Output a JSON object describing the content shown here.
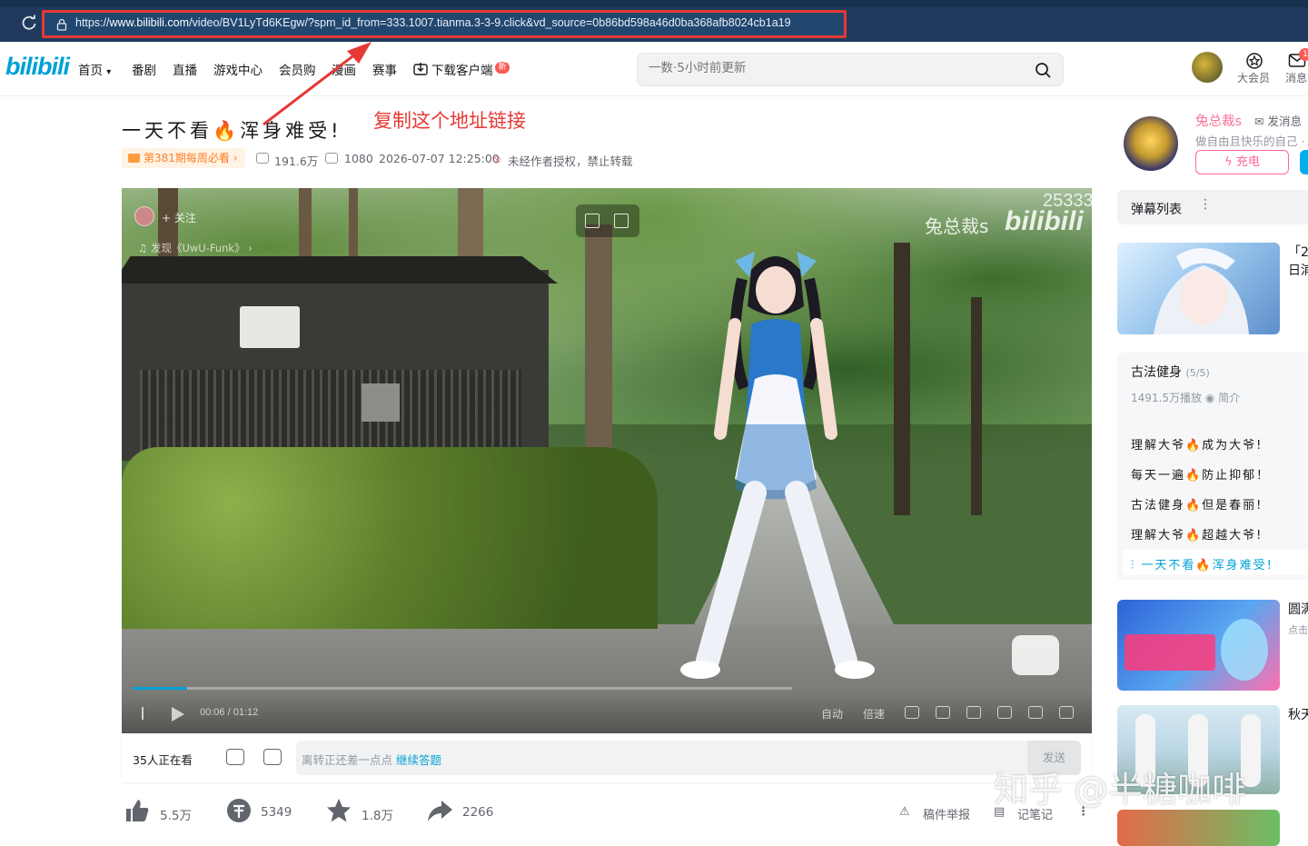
{
  "browser": {
    "url_prefix": "https://",
    "url_host": "www.bilibili.com",
    "url_rest": "/video/BV1LyTd6KEgw/?spm_id_from=333.1007.tianma.3-3-9.click&vd_source=0b86bd598a46d0ba368afb8024cb1a19"
  },
  "header": {
    "logo": "bilibili",
    "nav": [
      "首页",
      "番剧",
      "直播",
      "游戏中心",
      "会员购",
      "漫画",
      "赛事",
      "下载客户端"
    ],
    "nav_new_badge": "新",
    "search_placeholder": "一数·5小时前更新",
    "vip_label": "大会员",
    "msg_label": "消息",
    "msg_badge": "1"
  },
  "annotation": {
    "text": "复制这个地址链接",
    "color": "#e53935"
  },
  "video": {
    "title": "一天不看🔥浑身难受!",
    "weekly_tag": "第381期每周必看",
    "views": "191.6万",
    "danmaku_count": "1080",
    "publish_time": "2026-07-07 12:25:00",
    "copyright": "未经作者授权，禁止转载",
    "player": {
      "follow": "+ 关注",
      "music": "发现《UwU-Funk》",
      "watermark_name": "兔总裁s",
      "watermark_logo": "bilibili",
      "counter": "25333",
      "current_time": "00:06",
      "duration": "01:12",
      "progress": 0.083,
      "ctrl_auto": "自动",
      "ctrl_speed": "倍速"
    }
  },
  "danmaku_bar": {
    "viewers": "35人正在看",
    "placeholder": "离转正还差一点点 ",
    "continue_link": "继续答题",
    "send": "发送"
  },
  "actions": {
    "like": "5.5万",
    "coin": "5349",
    "favorite": "1.8万",
    "share": "2266",
    "report": "稿件举报",
    "notes": "记笔记"
  },
  "uploader": {
    "name": "兔总裁s",
    "send_msg": "发消息",
    "desc": "做自由且快乐的自己 ·",
    "charge": "充电"
  },
  "sidebar": {
    "danmaku_list": "弹幕列表",
    "rec1_title": "「2",
    "rec1_sub": "日浦",
    "collection": {
      "title": "古法健身",
      "count": "(5/5)",
      "plays": "1491.5万播放",
      "intro": "简介",
      "items": [
        "理解大爷🔥成为大爷!",
        "每天一遍🔥防止抑郁！",
        "古法健身🔥但是春丽!",
        "理解大爷🔥超越大爷!"
      ],
      "active": "一天不看🔥浑身难受!"
    },
    "rec2_title": "圆满",
    "rec2_sub": "点击",
    "rec3_title": "秋天"
  },
  "watermark": "知乎 @半糖咖啡"
}
